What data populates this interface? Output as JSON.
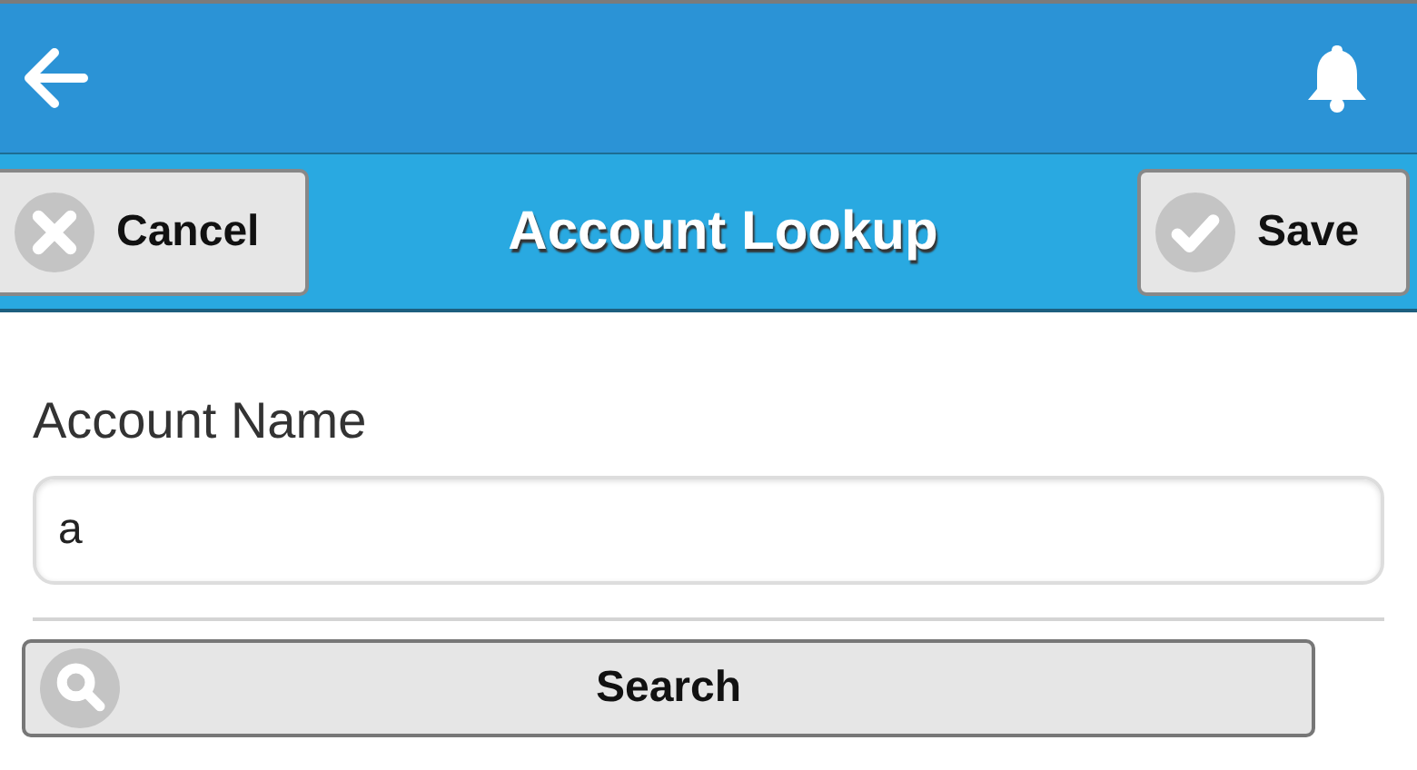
{
  "toolbar": {
    "title": "Account Lookup",
    "cancel_button": "Cancel",
    "save_button": "Save"
  },
  "form": {
    "label": "Account Name",
    "value": "a"
  },
  "search_button": "Search"
}
